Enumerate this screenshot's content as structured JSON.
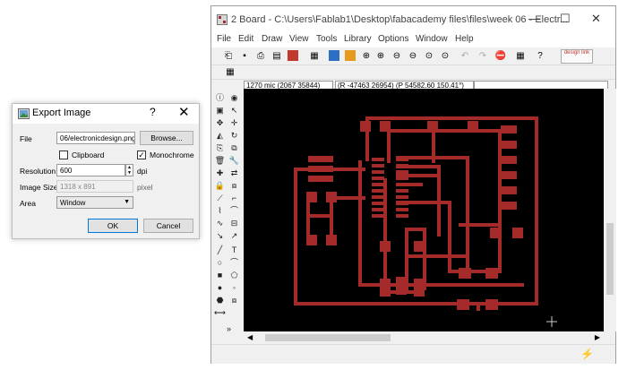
{
  "dialog": {
    "title": "Export Image",
    "help": "?",
    "close": "✕",
    "file_label": "File",
    "file_value": "06/electronicdesign.png",
    "browse_label": "Browse...",
    "clipboard_label": "Clipboard",
    "clipboard_checked": false,
    "monochrome_label": "Monochrome",
    "monochrome_checked": true,
    "resolution_label": "Resolution",
    "resolution_value": "600",
    "dpi_label": "dpi",
    "image_size_label": "Image Size",
    "image_size_value": "1318 x 891",
    "pixel_label": "pixel",
    "area_label": "Area",
    "area_value": "Window",
    "ok_label": "OK",
    "cancel_label": "Cancel"
  },
  "window": {
    "title": "2 Board - C:\\Users\\Fablab1\\Desktop\\fabacademy files\\files\\week 06 - Electr...",
    "controls": {
      "minimize": "—",
      "maximize": "☐",
      "close": "✕"
    },
    "menu": [
      "File",
      "Edit",
      "Draw",
      "View",
      "Tools",
      "Library",
      "Options",
      "Window",
      "Help"
    ],
    "coord_grid": "1270 mic (2067 35844)",
    "coord_polar": "(R -47463 26954) (P 54582.60 150.41°)",
    "design_link_label": "design link"
  },
  "colors": {
    "trace": "#a52a2a",
    "canvas": "#000000",
    "accent": "#0078d7"
  }
}
